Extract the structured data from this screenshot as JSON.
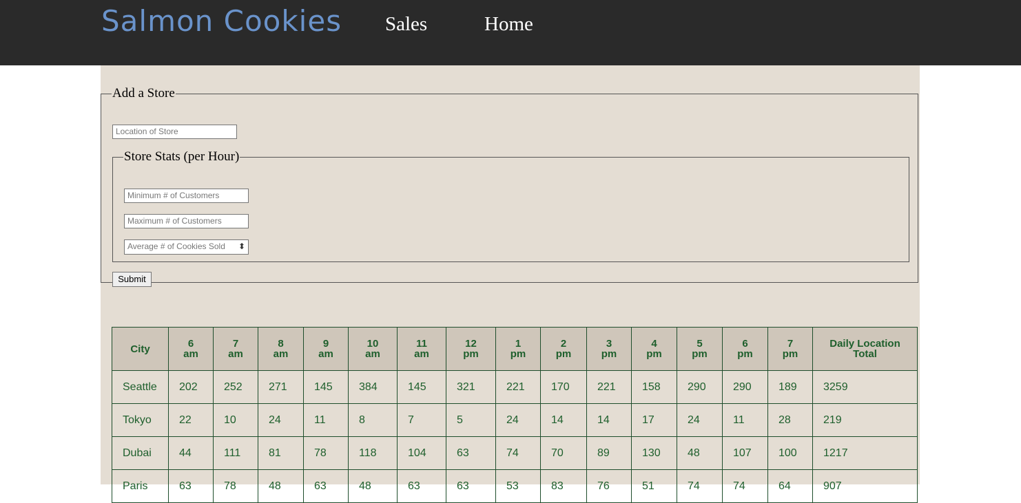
{
  "header": {
    "brand": "Salmon Cookies",
    "nav": [
      "Sales",
      "Home"
    ]
  },
  "form": {
    "legend": "Add a Store",
    "location_placeholder": "Location of Store",
    "stats_legend": "Store Stats (per Hour)",
    "min_placeholder": "Minimum # of Customers",
    "max_placeholder": "Maximum # of Customers",
    "avg_placeholder": "Average # of  Cookies Sold",
    "submit_label": "Submit"
  },
  "table": {
    "headers": [
      [
        "City"
      ],
      [
        "6",
        "am"
      ],
      [
        "7",
        "am"
      ],
      [
        "8",
        "am"
      ],
      [
        "9",
        "am"
      ],
      [
        "10",
        "am"
      ],
      [
        "11",
        "am"
      ],
      [
        "12",
        "pm"
      ],
      [
        "1",
        "pm"
      ],
      [
        "2",
        "pm"
      ],
      [
        "3",
        "pm"
      ],
      [
        "4",
        "pm"
      ],
      [
        "5",
        "pm"
      ],
      [
        "6",
        "pm"
      ],
      [
        "7",
        "pm"
      ],
      [
        "Daily Location",
        "Total"
      ]
    ],
    "rows": [
      [
        "Seattle",
        "202",
        "252",
        "271",
        "145",
        "384",
        "145",
        "321",
        "221",
        "170",
        "221",
        "158",
        "290",
        "290",
        "189",
        "3259"
      ],
      [
        "Tokyo",
        "22",
        "10",
        "24",
        "11",
        "8",
        "7",
        "5",
        "24",
        "14",
        "14",
        "17",
        "24",
        "11",
        "28",
        "219"
      ],
      [
        "Dubai",
        "44",
        "111",
        "81",
        "78",
        "118",
        "104",
        "63",
        "74",
        "70",
        "89",
        "130",
        "48",
        "107",
        "100",
        "1217"
      ],
      [
        "Paris",
        "63",
        "78",
        "48",
        "63",
        "48",
        "63",
        "63",
        "53",
        "83",
        "76",
        "51",
        "74",
        "74",
        "64",
        "907"
      ]
    ]
  }
}
